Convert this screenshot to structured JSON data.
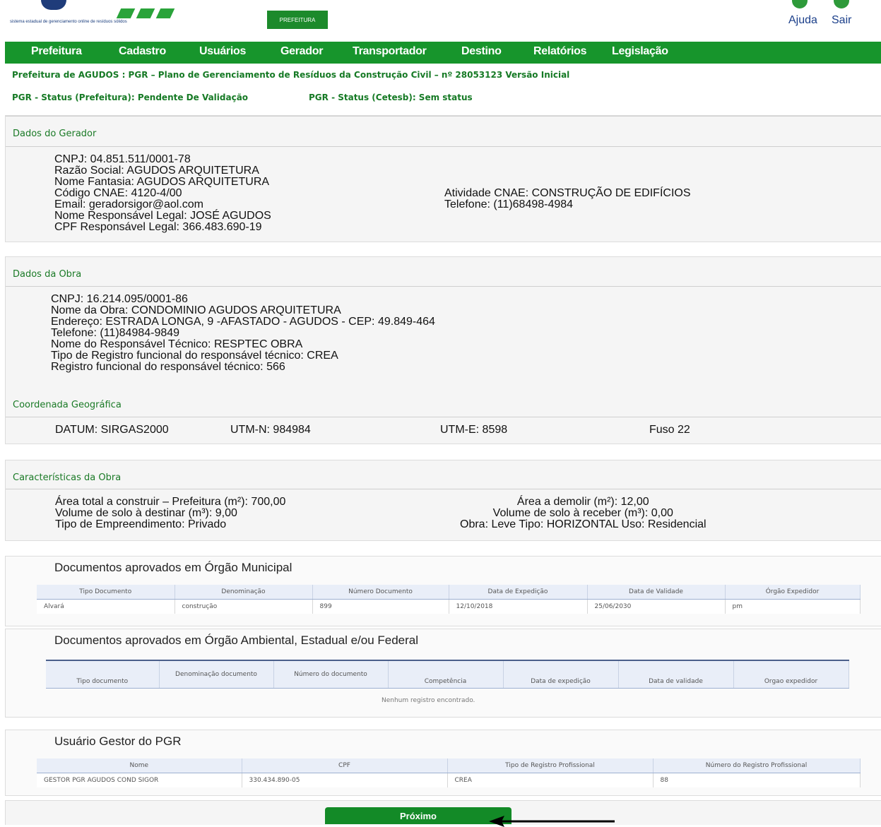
{
  "header": {
    "logo_caption": "sistema estadual de gerenciamento online de resíduos sólidos",
    "prefeitura_badge": "PREFEITURA",
    "help_label": "Ajuda",
    "exit_label": "Sair"
  },
  "nav": {
    "items": [
      "Prefeitura",
      "Cadastro",
      "Usuários",
      "Gerador",
      "Transportador",
      "Destino",
      "Relatórios",
      "Legislação"
    ]
  },
  "title_line": "Prefeitura de AGUDOS : PGR – Plano de Gerenciamento de Resíduos da Construção Civil – nº 28053123 Versão Inicial",
  "status_pref": "PGR - Status (Prefeitura): Pendente De Validação",
  "status_cetesb": "PGR - Status (Cetesb): Sem status",
  "gerador": {
    "title": "Dados do Gerador",
    "lines": [
      "CNPJ: 04.851.511/0001-78",
      "Razão Social: AGUDOS ARQUITETURA",
      "Nome Fantasia: AGUDOS ARQUITETURA",
      "Código CNAE: 4120-4/00",
      "Email: geradorsigor@aol.com",
      "Nome Responsável Legal: JOSÉ AGUDOS",
      "CPF Responsável Legal: 366.483.690-19"
    ],
    "atividade": "Atividade CNAE: CONSTRUÇÃO DE EDIFÍCIOS",
    "telefone": "Telefone: (11)68498-4984"
  },
  "obra": {
    "title": "Dados da Obra",
    "lines": [
      "CNPJ: 16.214.095/0001-86",
      "Nome da Obra: CONDOMINIO AGUDOS ARQUITETURA",
      "Endereço: ESTRADA LONGA, 9 -AFASTADO - AGUDOS - CEP: 49.849-464",
      "Telefone: (11)84984-9849",
      "Nome do Responsável Técnico: RESPTEC OBRA",
      "Tipo de Registro funcional do responsável técnico: CREA",
      "Registro funcional do responsável técnico: 566"
    ],
    "coord_title": "Coordenada Geográfica",
    "datum": "DATUM:  SIRGAS2000",
    "utm_n": "UTM-N: 984984",
    "utm_e": "UTM-E: 8598",
    "fuso": "Fuso 22"
  },
  "caracteristicas": {
    "title": "Características da Obra",
    "left": [
      "Área total a construir – Prefeitura (m²): 700,00",
      "Volume de solo à destinar (m³): 9,00",
      "Tipo de Empreendimento: Privado"
    ],
    "right": [
      "Área a demolir (m²): 12,00",
      "Volume de solo à receber (m³): 0,00",
      "Obra: Leve Tipo: HORIZONTAL Uso: Residencial"
    ]
  },
  "docs_municipal": {
    "title": "Documentos aprovados em Órgão Municipal",
    "headers": [
      "Tipo Documento",
      "Denominação",
      "Número Documento",
      "Data de Expedição",
      "Data de Validade",
      "Órgão Expedidor"
    ],
    "rows": [
      [
        "Alvará",
        "construção",
        "899",
        "12/10/2018",
        "25/06/2030",
        "pm"
      ]
    ]
  },
  "docs_ambiental": {
    "title": "Documentos aprovados em Órgão Ambiental, Estadual e/ou Federal",
    "headers": [
      "Tipo documento",
      "Denominação documento",
      "Número do documento",
      "Competência",
      "Data de expedição",
      "Data de validade",
      "Orgao expedidor"
    ],
    "empty": "Nenhum registro encontrado."
  },
  "gestor": {
    "title": "Usuário Gestor do PGR",
    "headers": [
      "Nome",
      "CPF",
      "Tipo de Registro Profissional",
      "Número do Registro Profissional"
    ],
    "rows": [
      [
        "GESTOR PGR AGUDOS COND SIGOR",
        "330.434.890-05",
        "CREA",
        "88"
      ]
    ]
  },
  "next_label": "Próximo",
  "colors": {
    "primary_green": "#17952c",
    "text_green": "#1a7a26",
    "link_blue": "#1b3f8a"
  }
}
